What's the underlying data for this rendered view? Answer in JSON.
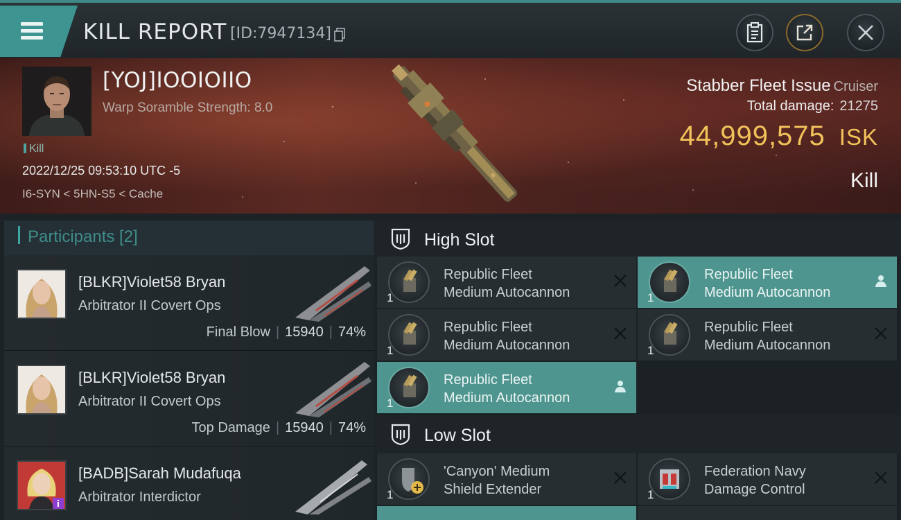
{
  "header": {
    "title": "KILL REPORT",
    "id_label": "[ID:7947134]"
  },
  "victim": {
    "name": "[YOJ]IOOIOIIO",
    "warp_scramble": "Warp Soramble Strength: 8.0",
    "tag": "Kill",
    "timestamp": "2022/12/25 09:53:10 UTC -5",
    "location": "I6-SYN < 5HN-S5 < Cache",
    "ship_name": "Stabber Fleet Issue",
    "ship_class": "Cruiser",
    "damage_label": "Total damage:",
    "damage_value": "21275",
    "isk_value": "44,999,575",
    "isk_unit": "ISK",
    "result": "Kill"
  },
  "participants": {
    "header": "Participants [2]",
    "rows": [
      {
        "name": "[BLKR]Violet58 Bryan",
        "ship": "Arbitrator II Covert Ops",
        "stat_label": "Final Blow",
        "damage": "15940",
        "percent": "74%"
      },
      {
        "name": "[BLKR]Violet58 Bryan",
        "ship": "Arbitrator II Covert Ops",
        "stat_label": "Top Damage",
        "damage": "15940",
        "percent": "74%"
      },
      {
        "name": "[BADB]Sarah Mudafuqa",
        "ship": "Arbitrator Interdictor",
        "stat_label": "",
        "damage": "",
        "percent": ""
      }
    ]
  },
  "fitting": {
    "high_slot_label": "High Slot",
    "low_slot_label": "Low Slot",
    "high": [
      {
        "line1": "Republic Fleet",
        "line2": "Medium Autocannon",
        "qty": "1",
        "status": "destroyed"
      },
      {
        "line1": "Republic Fleet",
        "line2": "Medium Autocannon",
        "qty": "1",
        "status": "dropped"
      },
      {
        "line1": "Republic Fleet",
        "line2": "Medium Autocannon",
        "qty": "1",
        "status": "destroyed"
      },
      {
        "line1": "Republic Fleet",
        "line2": "Medium Autocannon",
        "qty": "1",
        "status": "destroyed"
      },
      {
        "line1": "Republic Fleet",
        "line2": "Medium Autocannon",
        "qty": "1",
        "status": "dropped"
      }
    ],
    "low": [
      {
        "line1": "'Canyon' Medium",
        "line2": "Shield Extender",
        "qty": "1",
        "status": "destroyed"
      },
      {
        "line1": "Federation Navy",
        "line2": "Damage Control",
        "qty": "1",
        "status": "destroyed"
      }
    ]
  },
  "colors": {
    "accent": "#3d9490",
    "isk": "#f2c25a",
    "highlight": "#4f958f"
  }
}
